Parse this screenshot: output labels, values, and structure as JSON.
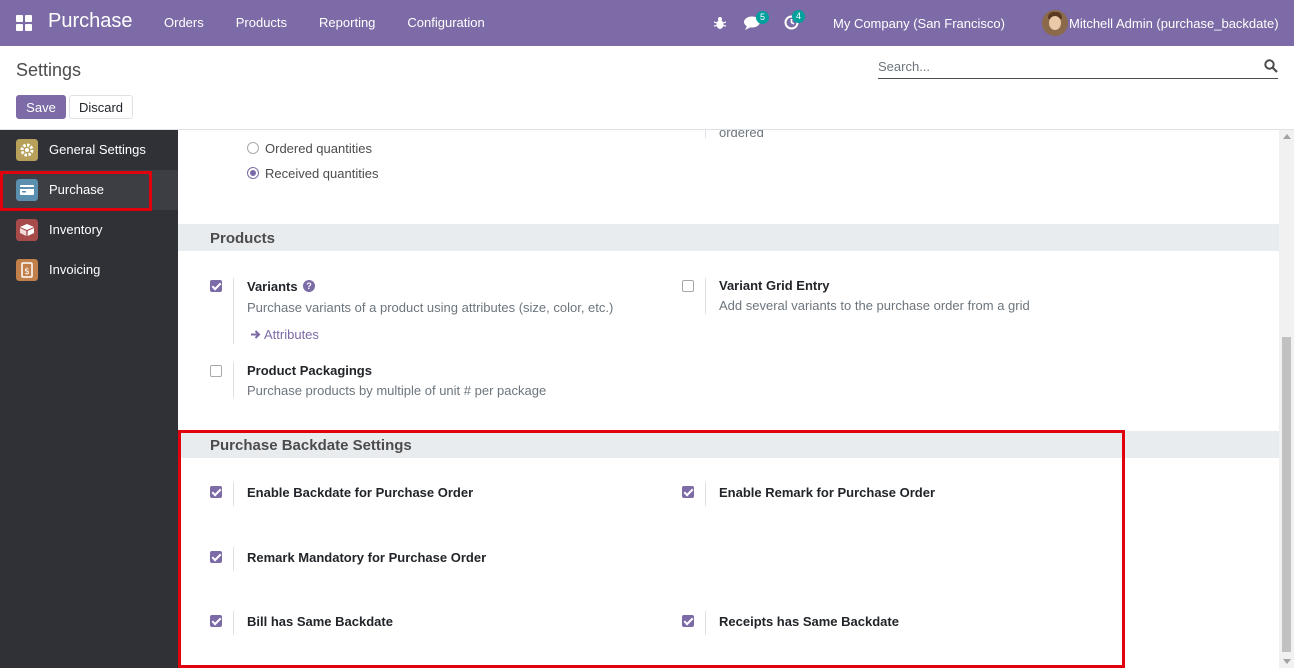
{
  "navbar": {
    "brand": "Purchase",
    "menu": [
      "Orders",
      "Products",
      "Reporting",
      "Configuration"
    ],
    "chat_count": "5",
    "activity_count": "4",
    "company": "My Company (San Francisco)",
    "user": "Mitchell Admin (purchase_backdate)",
    "color": "#7c6ba6"
  },
  "control": {
    "title": "Settings",
    "search_placeholder": "Search...",
    "save_label": "Save",
    "discard_label": "Discard"
  },
  "sidebar": {
    "items": [
      {
        "label": "General Settings",
        "icon": "gear-icon",
        "active": false
      },
      {
        "label": "Purchase",
        "icon": "purchase-app-icon",
        "active": true
      },
      {
        "label": "Inventory",
        "icon": "inventory-app-icon",
        "active": false
      },
      {
        "label": "Invoicing",
        "icon": "invoicing-app-icon",
        "active": false
      }
    ]
  },
  "bill_control": {
    "partial_right_text": "ordered",
    "options": [
      {
        "label": "Ordered quantities",
        "checked": false
      },
      {
        "label": "Received quantities",
        "checked": true
      }
    ]
  },
  "products_section": {
    "title": "Products",
    "variants": {
      "title": "Variants",
      "desc": "Purchase variants of a product using attributes (size, color, etc.)",
      "link": "Attributes",
      "checked": true
    },
    "variant_grid": {
      "title": "Variant Grid Entry",
      "desc": "Add several variants to the purchase order from a grid",
      "checked": false
    },
    "packagings": {
      "title": "Product Packagings",
      "desc": "Purchase products by multiple of unit # per package",
      "checked": false
    }
  },
  "backdate_section": {
    "title": "Purchase Backdate Settings",
    "settings": [
      {
        "title": "Enable Backdate for Purchase Order",
        "checked": true
      },
      {
        "title": "Enable Remark for Purchase Order",
        "checked": true
      },
      {
        "title": "Remark Mandatory for Purchase Order",
        "checked": true
      },
      {
        "title": "Bill has Same Backdate",
        "checked": true
      },
      {
        "title": "Receipts has Same Backdate",
        "checked": true
      }
    ]
  }
}
